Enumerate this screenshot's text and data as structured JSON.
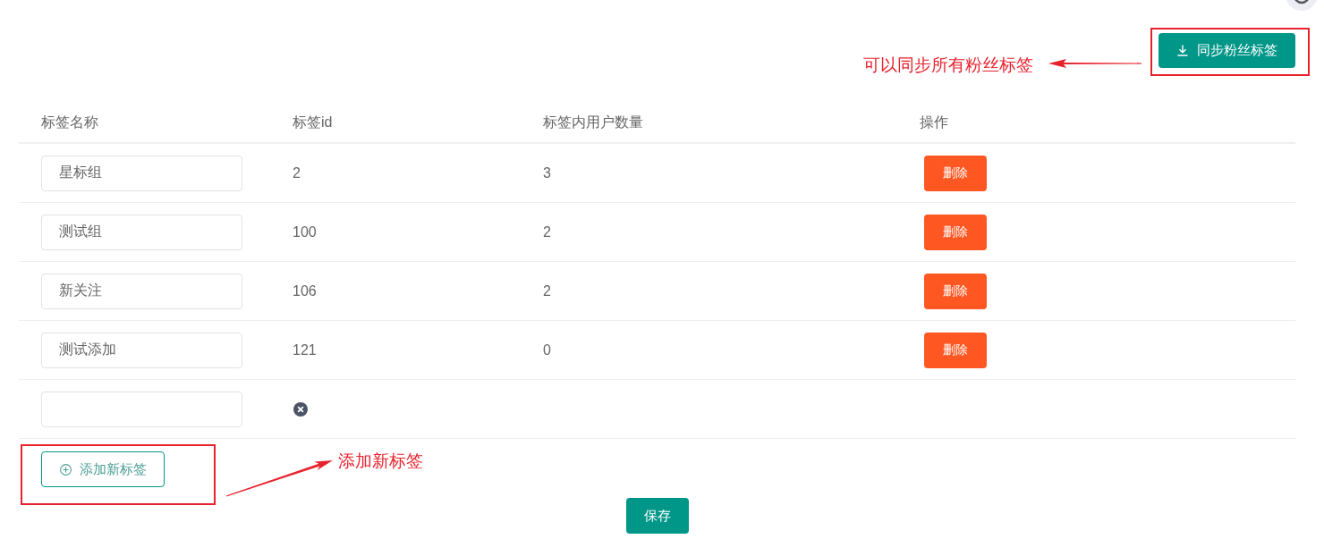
{
  "sync_button": {
    "label": "同步粉丝标签"
  },
  "table": {
    "columns": [
      "标签名称",
      "标签id",
      "标签内用户数量",
      "操作"
    ],
    "rows": [
      {
        "kind": "tag",
        "name": "星标组",
        "id": "2",
        "count": "3",
        "action": "删除"
      },
      {
        "kind": "tag",
        "name": "测试组",
        "id": "100",
        "count": "2",
        "action": "删除"
      },
      {
        "kind": "tag",
        "name": "新关注",
        "id": "106",
        "count": "2",
        "action": "删除"
      },
      {
        "kind": "tag",
        "name": "测试添加",
        "id": "121",
        "count": "0",
        "action": "删除"
      },
      {
        "kind": "draft"
      }
    ]
  },
  "add_button": {
    "label": "添加新标签"
  },
  "save_button": {
    "label": "保存"
  },
  "annotations": [
    {
      "text": "可以同步所有粉丝标签"
    },
    {
      "text": "添加新标签"
    }
  ]
}
